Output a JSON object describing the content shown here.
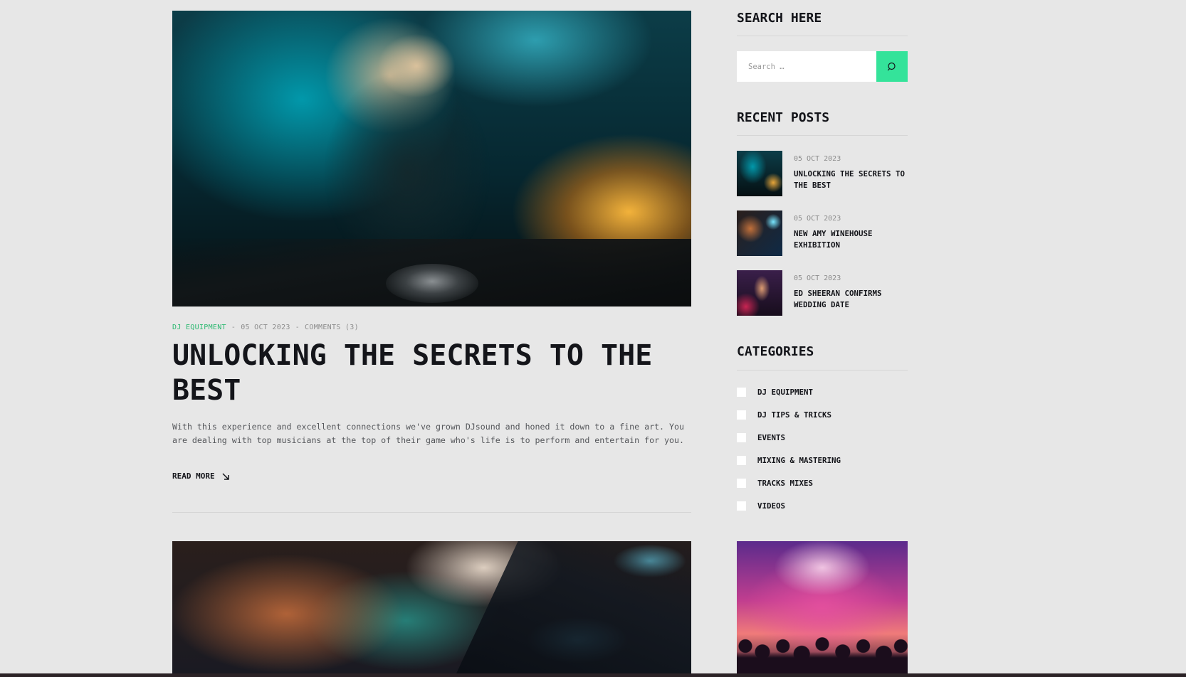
{
  "post": {
    "category": "DJ EQUIPMENT",
    "date": "05 OCT 2023",
    "comments": "COMMENTS (3)",
    "separator": "-",
    "title": "UNLOCKING THE SECRETS TO THE BEST",
    "excerpt": "With this experience and excellent connections we've grown DJsound and honed it down to a fine art. You are dealing with top musicians at the top of their game who's life is to perform and entertain for you.",
    "read_more": "READ MORE",
    "image_icon": "dj-at-turntables-image"
  },
  "next_post": {
    "image_icon": "crowd-dancing-image"
  },
  "sidebar": {
    "search": {
      "title": "SEARCH HERE",
      "placeholder": "Search …",
      "button_icon": "search-icon"
    },
    "recent_posts": {
      "title": "RECENT POSTS",
      "items": [
        {
          "date": "05 OCT 2023",
          "title": "UNLOCKING THE SECRETS TO THE BEST"
        },
        {
          "date": "05 OCT 2023",
          "title": "NEW AMY WINEHOUSE EXHIBITION"
        },
        {
          "date": "05 OCT 2023",
          "title": "ED SHEERAN CONFIRMS WEDDING DATE"
        }
      ]
    },
    "categories": {
      "title": "CATEGORIES",
      "items": [
        "DJ EQUIPMENT",
        "DJ TIPS & TRICKS",
        "EVENTS",
        "MIXING & MASTERING",
        "TRACKS MIXES",
        "VIDEOS"
      ]
    }
  },
  "colors": {
    "background": "#e7e7e7",
    "accent": "#34e39a",
    "category_text": "#2bb870",
    "heading": "#14151a",
    "muted": "#8c8c8c"
  }
}
